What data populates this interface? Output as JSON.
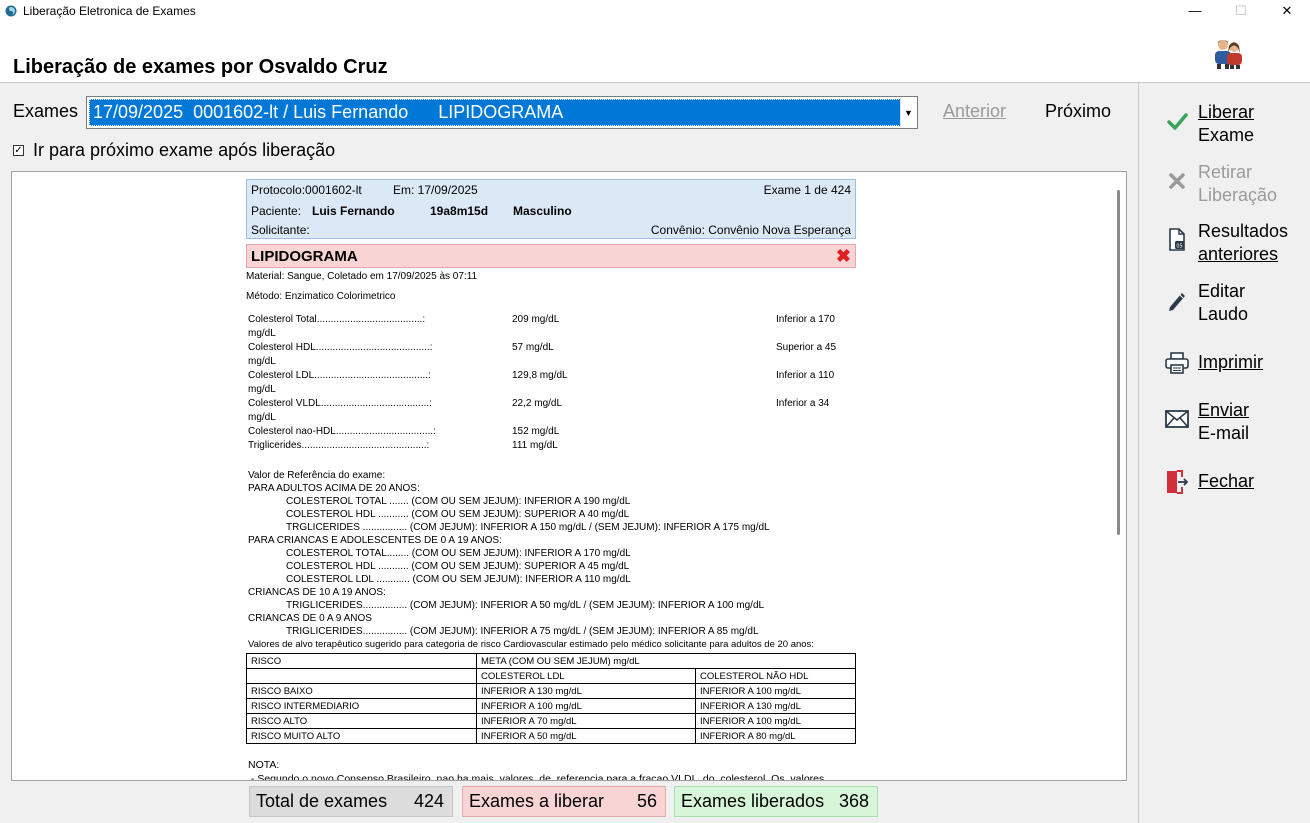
{
  "window": {
    "title": "Liberação Eletronica de Exames",
    "minimize": "—",
    "maximize": "☐",
    "close": "✕"
  },
  "header": {
    "title": "Liberação de exames por Osvaldo Cruz"
  },
  "exam_selector": {
    "label": "Exames",
    "selected": "17/09/2025  0001602-lt / Luis Fernando      LIPIDOGRAMA",
    "prev_label": "Anterior",
    "next_label": "Próximo",
    "auto_next_checked": true,
    "auto_next_label": "Ir para próximo exame após liberação"
  },
  "report": {
    "protocolo": "Protocolo:0001602-lt",
    "em": "Em: 17/09/2025",
    "exam_counter": "Exame 1 de 424",
    "paciente_label": "Paciente:",
    "paciente_nome": "Luis Fernando",
    "idade": "19a8m15d",
    "sexo": "Masculino",
    "solicitante": "Solicitante:",
    "convenio": "Convênio: Convênio Nova Esperança",
    "exam_name": "LIPIDOGRAMA",
    "material": "Material: Sangue, Coletado em 17/09/2025 às 07:11",
    "metodo": "Método: Enzimatico Colorimetrico",
    "results": [
      {
        "name": "Colesterol Total......................................:",
        "value": "209 mg/dL",
        "ref": "Inferior a 170",
        "unit2": "mg/dL"
      },
      {
        "name": "Colesterol HDL.........................................:",
        "value": "57 mg/dL",
        "ref": "Superior a 45",
        "unit2": "mg/dL"
      },
      {
        "name": "Colesterol LDL.........................................:",
        "value": "129,8 mg/dL",
        "ref": "Inferior a 110",
        "unit2": "mg/dL"
      },
      {
        "name": "Colesterol VLDL.......................................:",
        "value": "22,2 mg/dL",
        "ref": "Inferior a 34",
        "unit2": "mg/dL"
      },
      {
        "name": "Colesterol nao-HDL...................................:",
        "value": "152 mg/dL",
        "ref": "",
        "unit2": ""
      },
      {
        "name": "Triglicerides.............................................:",
        "value": "111 mg/dL",
        "ref": "",
        "unit2": ""
      }
    ],
    "ref_title": "Valor de Referência do exame:",
    "ref_lines": [
      {
        "indent": false,
        "text": "PARA ADULTOS ACIMA DE 20  ANOS:"
      },
      {
        "indent": true,
        "text": "COLESTEROL TOTAL .......  (COM OU SEM JEJUM): INFERIOR A 190 mg/dL"
      },
      {
        "indent": true,
        "text": "COLESTEROL HDL ...........  (COM OU SEM JEJUM): SUPERIOR A 40 mg/dL"
      },
      {
        "indent": true,
        "text": "TRGLICERIDES ................  (COM JEJUM): INFERIOR A 150 mg/dL / (SEM JEJUM): INFERIOR A 175 mg/dL"
      },
      {
        "indent": false,
        "text": "PARA CRIANCAS E ADOLESCENTES DE 0 A 19 ANOS:"
      },
      {
        "indent": true,
        "text": "COLESTEROL TOTAL........  (COM OU SEM JEJUM): INFERIOR A 170 mg/dL"
      },
      {
        "indent": true,
        "text": "COLESTEROL HDL ...........  (COM OU SEM JEJUM): SUPERIOR A 45 mg/dL"
      },
      {
        "indent": true,
        "text": "COLESTEROL LDL ............  (COM OU SEM JEJUM): INFERIOR A 110 mg/dL"
      },
      {
        "indent": false,
        "text": "CRIANCAS DE 10 A 19 ANOS:"
      },
      {
        "indent": true,
        "text": "TRIGLICERIDES................  (COM JEJUM): INFERIOR A 50 mg/dL / (SEM JEJUM): INFERIOR A 100 mg/dL"
      },
      {
        "indent": false,
        "text": "CRIANCAS DE 0 A 9 ANOS"
      },
      {
        "indent": true,
        "text": "TRIGLICERIDES................  (COM JEJUM): INFERIOR A 75 mg/dL / (SEM JEJUM): INFERIOR A 85 mg/dL"
      },
      {
        "indent": false,
        "text": "Valores de alvo terapêutico sugerido para categoria de risco Cardiovascular estimado pelo médico solicitante para adultos de 20 anos:"
      }
    ],
    "risk_table": {
      "h_risco": "RISCO",
      "h_meta": "META (COM OU SEM JEJUM) mg/dL",
      "h_ldl": "COLESTEROL LDL",
      "h_naohdl": "COLESTEROL NÃO HDL",
      "rows": [
        {
          "risco": "RISCO BAIXO",
          "ldl": "INFERIOR A 130 mg/dL",
          "naohdl": "INFERIOR A 100 mg/dL"
        },
        {
          "risco": "RISCO INTERMEDIARIO",
          "ldl": "INFERIOR A 100 mg/dL",
          "naohdl": "INFERIOR A 130 mg/dL"
        },
        {
          "risco": "RISCO ALTO",
          "ldl": "INFERIOR A 70 mg/dL",
          "naohdl": "INFERIOR A 100 mg/dL"
        },
        {
          "risco": "RISCO MUITO ALTO",
          "ldl": "INFERIOR A 50 mg/dL",
          "naohdl": "INFERIOR A 80 mg/dL"
        }
      ]
    },
    "nota_title": "NOTA:",
    "nota_text": " - Segundo o novo Consenso Brasileiro, nao ha mais  valores  de  referencia para a fracao VLDL  do  colesterol. Os  valores"
  },
  "counters": {
    "total_label": "Total de exames",
    "total_value": "424",
    "liberar_label": "Exames a liberar",
    "liberar_value": "56",
    "liberados_label": "Exames liberados",
    "liberados_value": "368"
  },
  "sidebar": {
    "liberar": [
      "Liberar",
      "Exame"
    ],
    "retirar": [
      "Retirar",
      "Liberação"
    ],
    "resultados": [
      "Resultados",
      "anteriores"
    ],
    "editar": [
      "Editar",
      "Laudo"
    ],
    "imprimir": "Imprimir",
    "enviar": [
      "Enviar",
      "E-mail"
    ],
    "fechar": "Fechar"
  },
  "colors": {
    "selection_blue": "#0078d7",
    "check_green": "#3aa35a",
    "close_red": "#e02020",
    "header_blue": "#dbe9f7",
    "exam_pink": "#f8d4d4",
    "liberados_green": "#d6f5d9"
  }
}
